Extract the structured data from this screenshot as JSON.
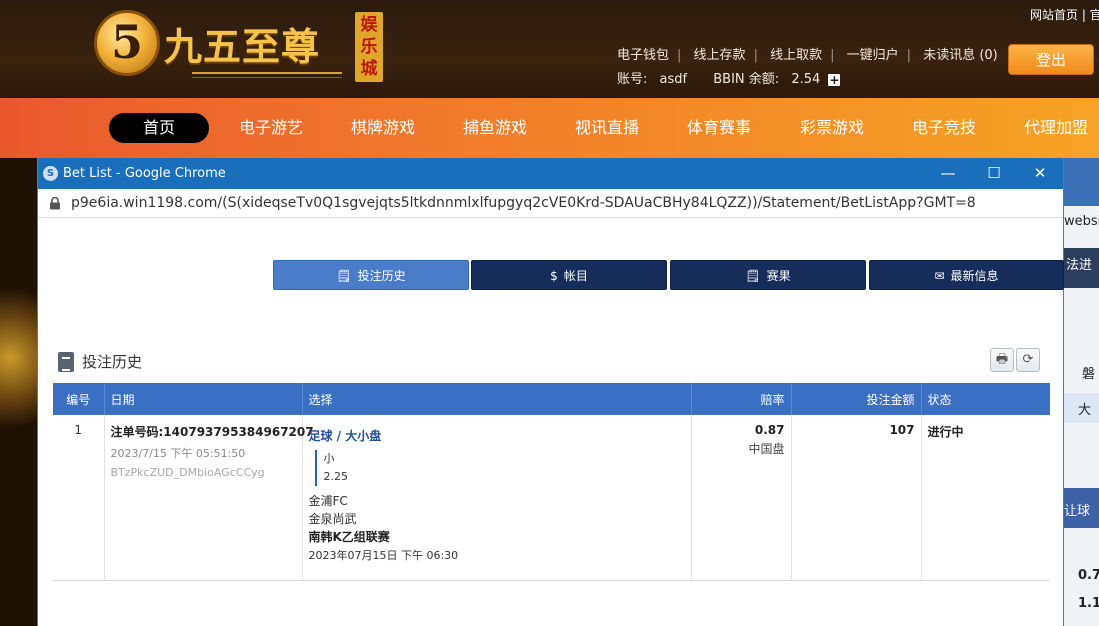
{
  "site": {
    "logo_numeral": "5",
    "logo_text": "九五至尊",
    "logo_badge": "娱乐城",
    "top_links": "网站首页 | 官",
    "user_links": [
      "电子钱包",
      "线上存款",
      "线上取款",
      "一键归户",
      "未读讯息 (0)"
    ],
    "account_label": "账号:",
    "account_value": "asdf",
    "balance_label": "BBIN 余额:",
    "balance_value": "2.54",
    "login_button": "登出",
    "nav": [
      "首页",
      "电子游艺",
      "棋牌游戏",
      "捕鱼游戏",
      "视讯直播",
      "体育赛事",
      "彩票游戏",
      "电子竞技",
      "代理加盟"
    ],
    "right_texts": [
      "websi",
      "法进",
      "磐",
      "大",
      "让球",
      "0.7",
      "1.1"
    ]
  },
  "window": {
    "title": "Bet List - Google Chrome",
    "url": "p9e6ia.win1198.com/(S(xideqseTv0Q1sgvejqts5ltkdnnmlxlfupgyq2cVE0Krd-SDAUaCBHy84LQZZ))/Statement/BetListApp?GMT=8",
    "minimize": "—",
    "maximize": "☐",
    "close": "✕"
  },
  "tabs": [
    {
      "icon": "🗒",
      "label": "投注历史"
    },
    {
      "icon": "$",
      "label": "帐目"
    },
    {
      "icon": "🗒",
      "label": "赛果"
    },
    {
      "icon": "✉",
      "label": "最新信息"
    }
  ],
  "section": {
    "title": "投注历史",
    "print_icon": "🖶",
    "refresh_icon": "⟳"
  },
  "table": {
    "headers": [
      "编号",
      "日期",
      "选择",
      "赔率",
      "投注金额",
      "状态"
    ],
    "rows": [
      {
        "no": "1",
        "ticket": "注单号码:140793795384967207",
        "datetime": "2023/7/15 下午 05:51:50",
        "ref": "BTzPkcZUD_DMbioAGcCCyg",
        "market": "足球 / 大小盘",
        "pick": "小",
        "line": "2.25",
        "home": "金浦FC",
        "away": "金泉尚武",
        "league": "南韩K乙组联赛",
        "event_date": "2023年07月15日 下午 06:30",
        "odds": "0.87",
        "odds_type": "中国盘",
        "amount": "107",
        "status": "进行中"
      }
    ]
  }
}
